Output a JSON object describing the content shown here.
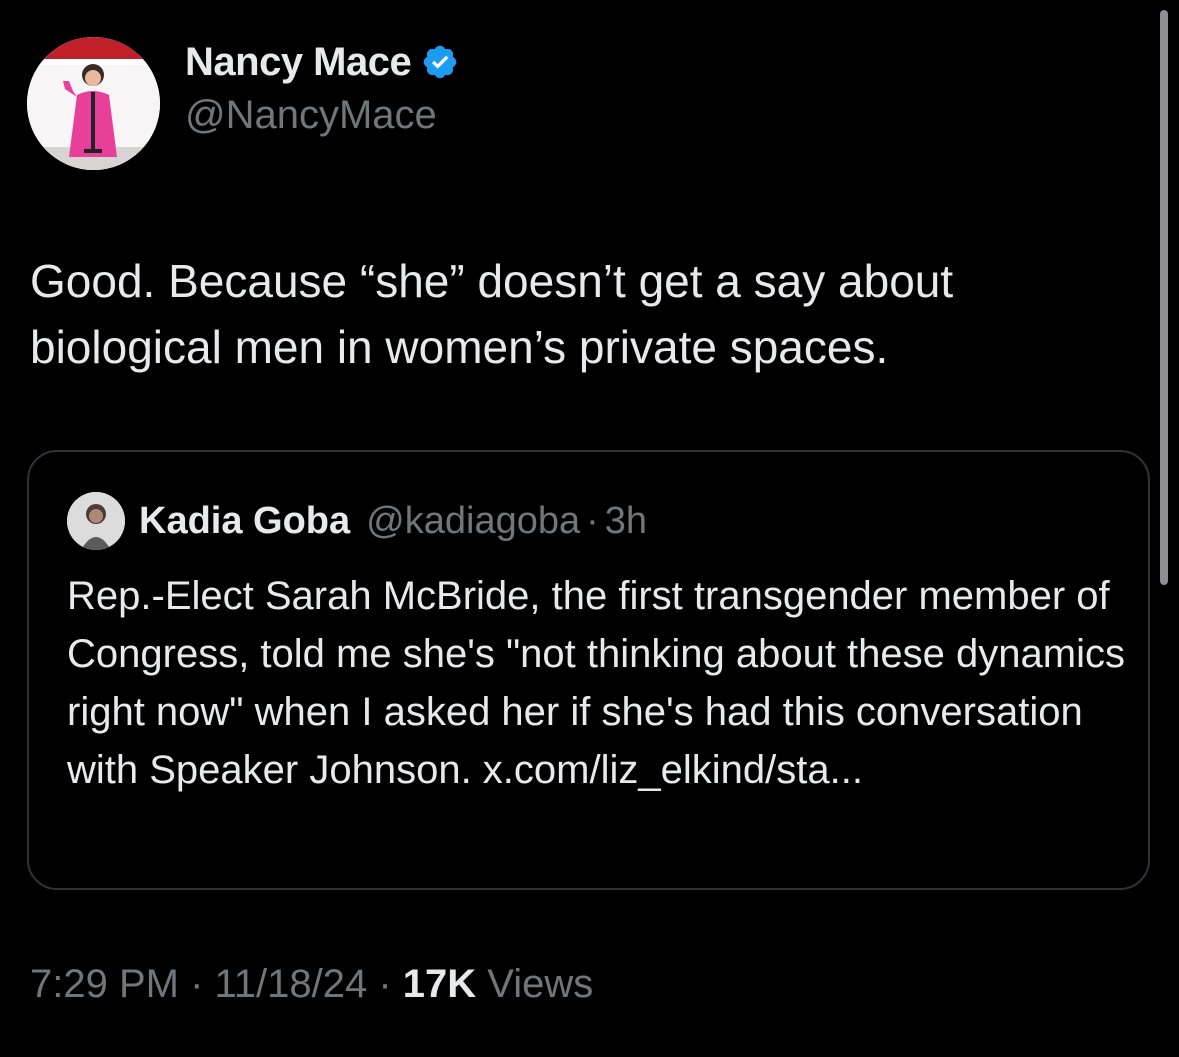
{
  "author": {
    "display_name": "Nancy Mace",
    "handle": "@NancyMace",
    "verified_icon": "verified-badge-icon",
    "verified_color": "#1d9bf0"
  },
  "tweet": {
    "text": "Good. Because “she” doesn’t get a say about biological men in women’s private spaces."
  },
  "quoted_tweet": {
    "display_name": "Kadia Goba",
    "handle": "@kadiagoba",
    "separator": "·",
    "time": "3h",
    "text": "Rep.-Elect Sarah McBride, the first transgender member of Congress, told me she's \"not thinking about these dynamics right now\"  when I asked her if she's had this conversation with Speaker Johnson. x.com/liz_elkind/sta..."
  },
  "meta": {
    "time": "7:29 PM",
    "sep1": " · ",
    "date": "11/18/24",
    "sep2": " · ",
    "views_count": "17K",
    "views_label": " Views"
  }
}
